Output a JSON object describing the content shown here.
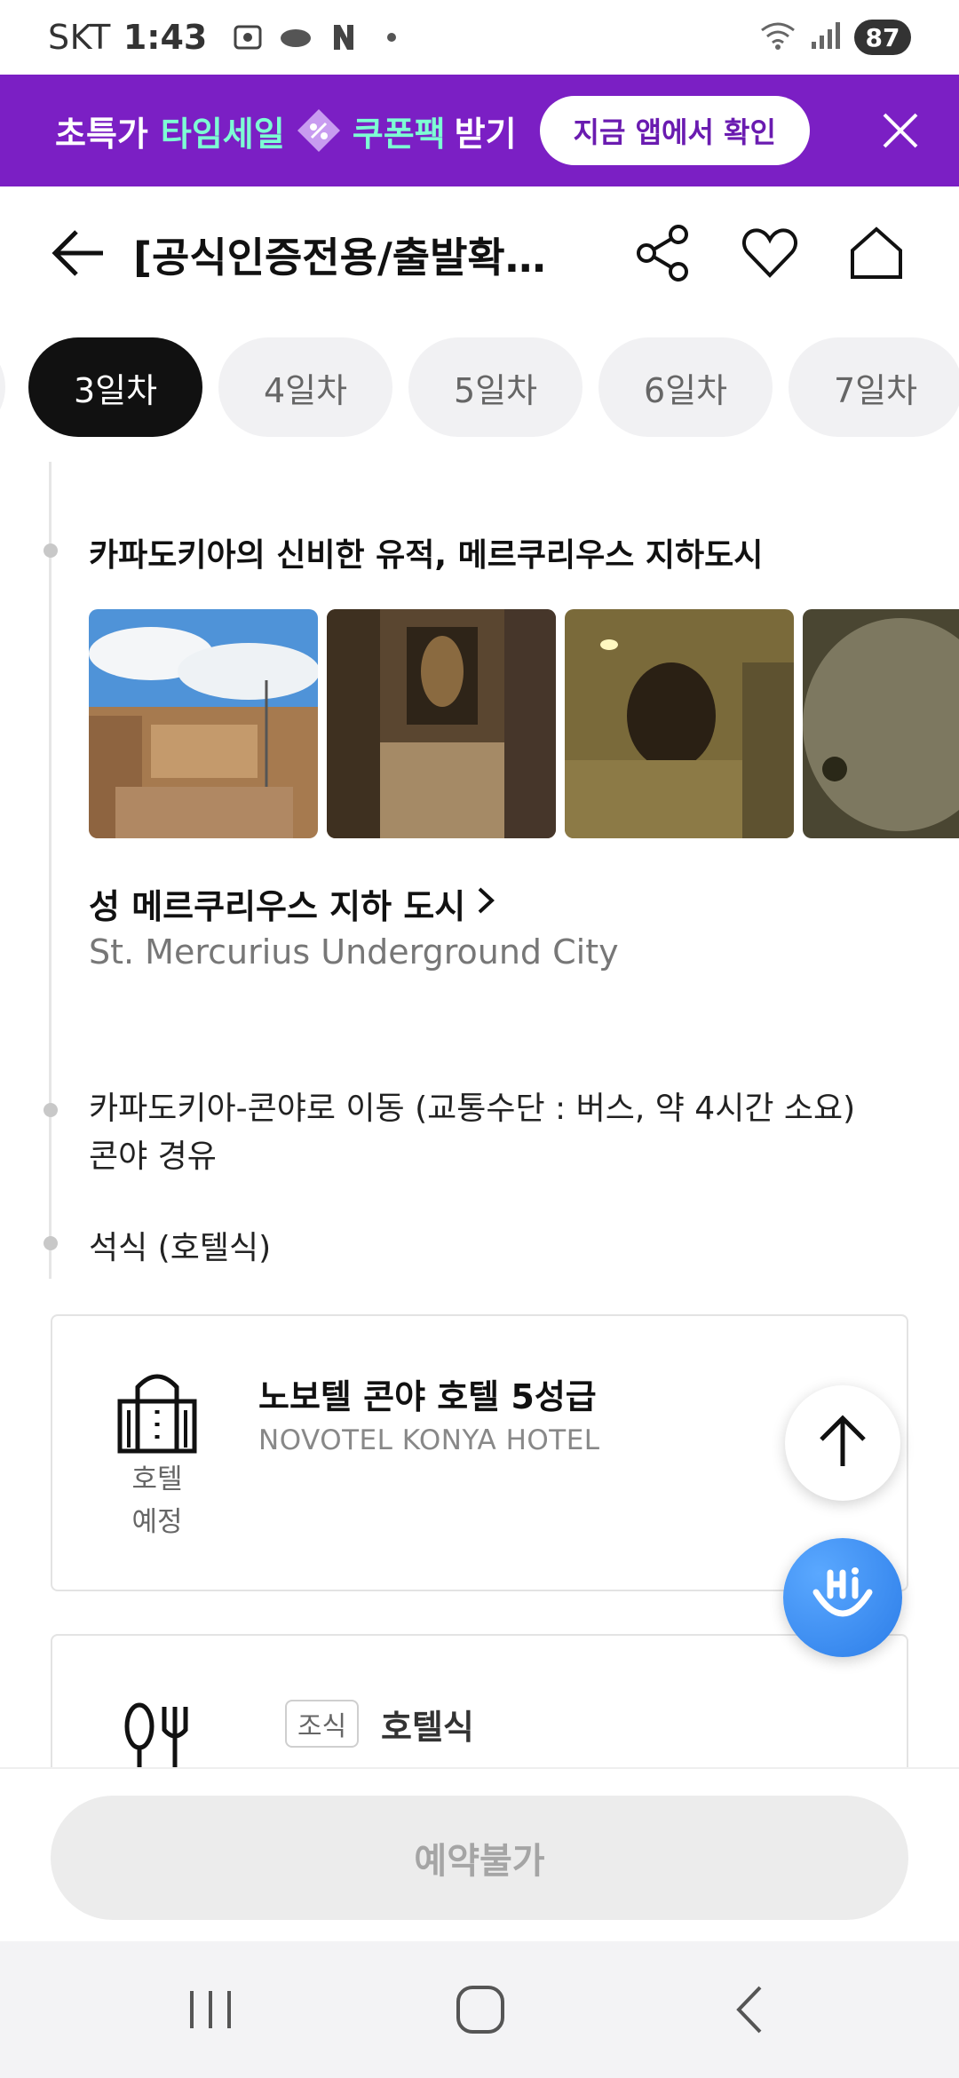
{
  "status_bar": {
    "carrier": "SKT",
    "time": "1:43",
    "battery": "87"
  },
  "promo": {
    "prefix": "초특가",
    "highlight_1": "타임세일",
    "highlight_2": "쿠폰팩",
    "suffix": "받기",
    "cta": "지금 앱에서 확인"
  },
  "header": {
    "title": "[공식인증전용/출발확…"
  },
  "tabs": [
    {
      "label": "3일차",
      "active": true
    },
    {
      "label": "4일차",
      "active": false
    },
    {
      "label": "5일차",
      "active": false
    },
    {
      "label": "6일차",
      "active": false
    },
    {
      "label": "7일차",
      "active": false
    }
  ],
  "itinerary": {
    "spot_title": "카파도키아의 신비한 유적, 메르쿠리우스 지하도시",
    "poi_name": "성 메르쿠리우스 지하 도시",
    "poi_name_en": "St. Mercurius Underground City",
    "move_line_1": "카파도키아-콘야로 이동 (교통수단 : 버스, 약 4시간 소요)",
    "move_line_2": "콘야 경유",
    "dinner": "석식 (호텔식)"
  },
  "hotel_card": {
    "icon_label_1": "호텔",
    "icon_label_2": "예정",
    "name": "노보텔 콘야 호텔 5성급",
    "name_en": "NOVOTEL KONYA HOTEL"
  },
  "meal_card": {
    "badge": "조식",
    "name": "호텔식"
  },
  "bottom": {
    "book_label": "예약불가"
  },
  "colors": {
    "promo_bg": "#7b1fc4",
    "promo_highlight": "#7dffd4",
    "active_tab": "#111111",
    "fab_hi": "#2c7de8"
  },
  "icons": [
    "back-arrow-icon",
    "share-icon",
    "heart-icon",
    "home-icon",
    "close-icon",
    "chevron-right-icon",
    "hotel-building-icon",
    "utensils-icon",
    "arrow-up-icon",
    "hi-chat-icon"
  ]
}
